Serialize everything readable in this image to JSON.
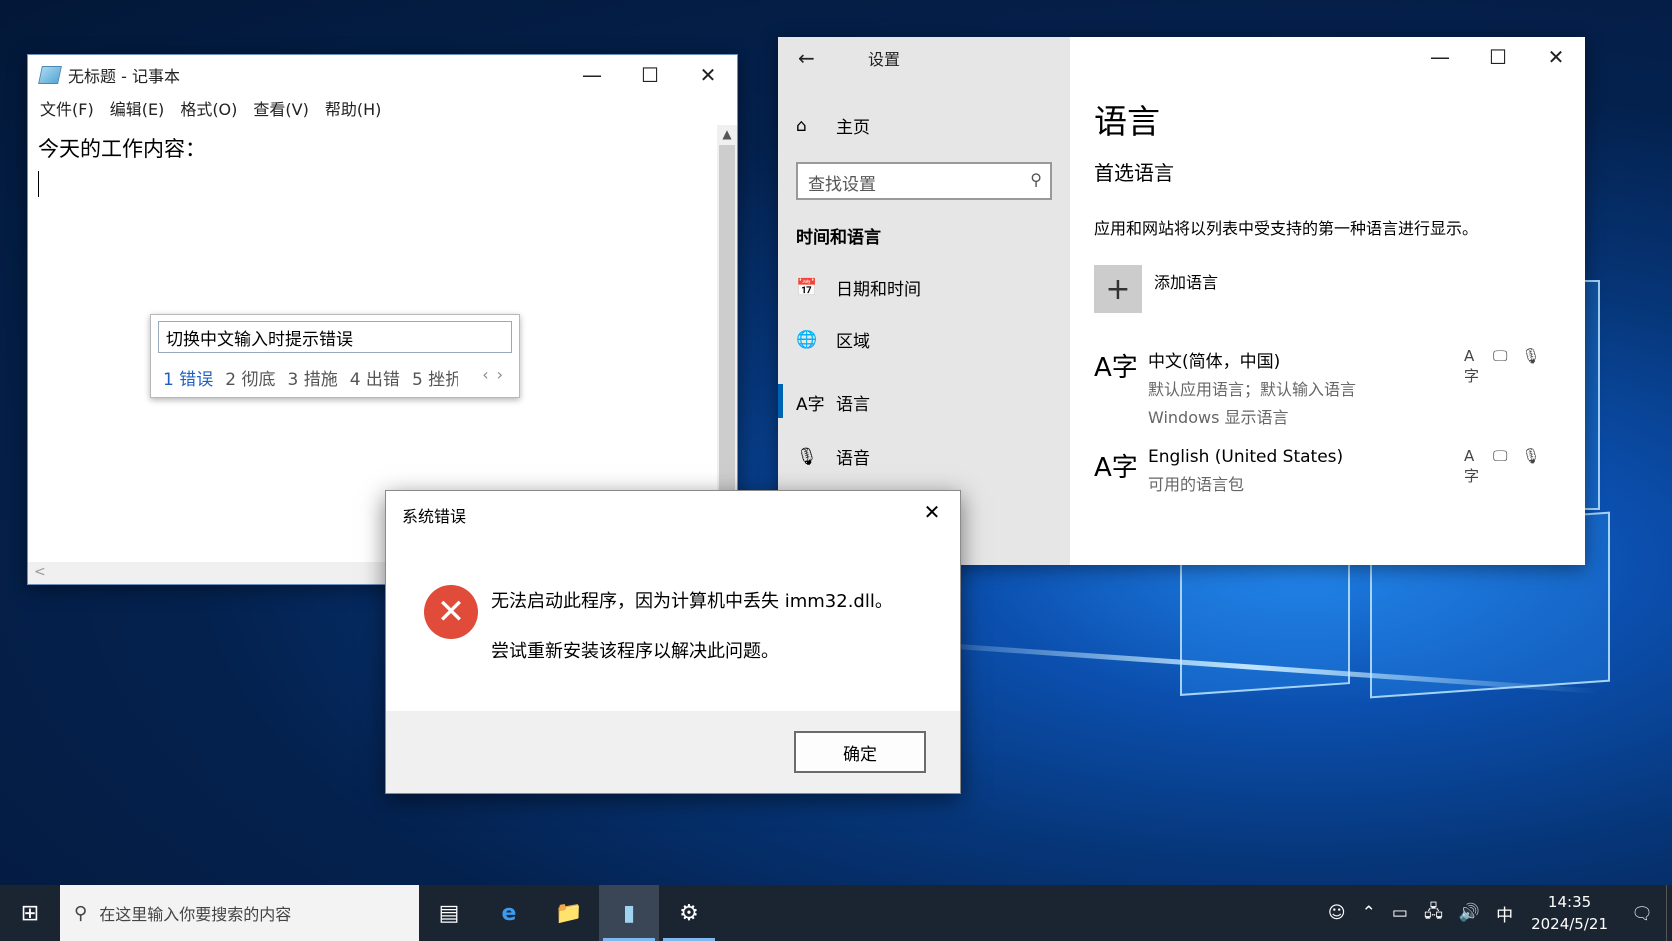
{
  "notepad": {
    "title": "无标题 - 记事本",
    "menu": [
      "文件(F)",
      "编辑(E)",
      "格式(O)",
      "查看(V)",
      "帮助(H)"
    ],
    "content": "今天的工作内容："
  },
  "ime": {
    "composition": "切换中文输入时提示错误",
    "candidates": [
      "1 错误",
      "2 彻底",
      "3 措施",
      "4 出错",
      "5 挫折"
    ]
  },
  "settings": {
    "title": "设置",
    "home": "主页",
    "search_placeholder": "查找设置",
    "category": "时间和语言",
    "nav": [
      "日期和时间",
      "区域",
      "语言",
      "语音"
    ],
    "heading": "语言",
    "subheading": "首选语言",
    "description": "应用和网站将以列表中受支持的第一种语言进行显示。",
    "add_language": "添加语言",
    "languages": [
      {
        "name": "中文(简体，中国)",
        "sub1": "默认应用语言；默认输入语言",
        "sub2": "Windows 显示语言"
      },
      {
        "name": "English (United States)",
        "sub1": "可用的语言包",
        "sub2": ""
      }
    ]
  },
  "error_dialog": {
    "title": "系统错误",
    "message1": "无法启动此程序，因为计算机中丢失 imm32.dll。",
    "message2": "尝试重新安装该程序以解决此问题。",
    "ok_label": "确定"
  },
  "taskbar": {
    "search_placeholder": "在这里输入你要搜索的内容",
    "ime_indicator": "中",
    "time": "14:35",
    "date": "2024/5/21"
  }
}
